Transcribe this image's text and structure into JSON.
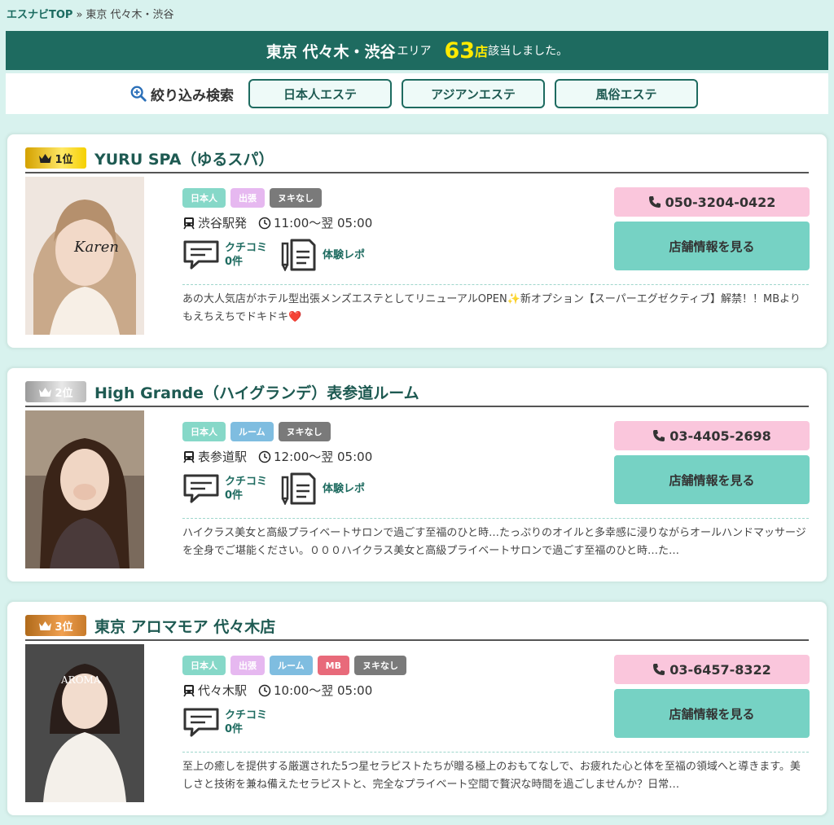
{
  "breadcrumb": {
    "home": "エスナビTOP",
    "sep": "»",
    "current": "東京 代々木・渋谷"
  },
  "banner": {
    "area": "東京 代々木・渋谷",
    "area_suffix": "エリア",
    "count": "63",
    "count_unit": "店",
    "count_text": "該当しました。"
  },
  "filter": {
    "label": "絞り込み検索",
    "buttons": [
      "日本人エステ",
      "アジアンエステ",
      "風俗エステ"
    ]
  },
  "shops": [
    {
      "rank": "1位",
      "name": "YURU SPA（ゆるスパ）",
      "tags": [
        "日本人",
        "出張",
        "ヌキなし"
      ],
      "station": "渋谷駅発",
      "hours": "11:00〜翌 05:00",
      "review_label": "クチコミ",
      "review_count": "0件",
      "report_label": "体験レポ",
      "phone": "050-3204-0422",
      "detail_label": "店舗情報を見る",
      "description": "あの大人気店がホテル型出張メンズエステとしてリニューアルOPEN✨新オプション【スーパーエグゼクティブ】解禁！！MBよりもえちえちでドキドキ❤️"
    },
    {
      "rank": "2位",
      "name": "High Grande（ハイグランデ）表参道ルーム",
      "tags": [
        "日本人",
        "ルーム",
        "ヌキなし"
      ],
      "station": "表参道駅",
      "hours": "12:00〜翌 05:00",
      "review_label": "クチコミ",
      "review_count": "0件",
      "report_label": "体験レポ",
      "phone": "03-4405-2698",
      "detail_label": "店舗情報を見る",
      "description": "ハイクラス美女と高級プライベートサロンで過ごす至福のひと時…たっぷりのオイルと多幸感に浸りながらオールハンドマッサージを全身でご堪能ください。０００ハイクラス美女と高級プライベートサロンで過ごす至福のひと時…た…"
    },
    {
      "rank": "3位",
      "name": "東京 アロマモア 代々木店",
      "tags": [
        "日本人",
        "出張",
        "ルーム",
        "MB",
        "ヌキなし"
      ],
      "station": "代々木駅",
      "hours": "10:00〜翌 05:00",
      "review_label": "クチコミ",
      "review_count": "0件",
      "phone": "03-6457-8322",
      "detail_label": "店舗情報を見る",
      "description": "至上の癒しを提供する厳選された5つ星セラピストたちが贈る極上のおもてなしで、お疲れた心と体を至福の領域へと導きます。美しさと技術を兼ね備えたセラピストと、完全なプライベート空間で贅沢な時間を過ごしませんか？日常…"
    }
  ],
  "colors": {
    "background": "#d8f2ee",
    "primary": "#1e6b60",
    "count_highlight": "#ffea00",
    "phone_button": "#fac6dc",
    "detail_button": "#76d2c4"
  }
}
